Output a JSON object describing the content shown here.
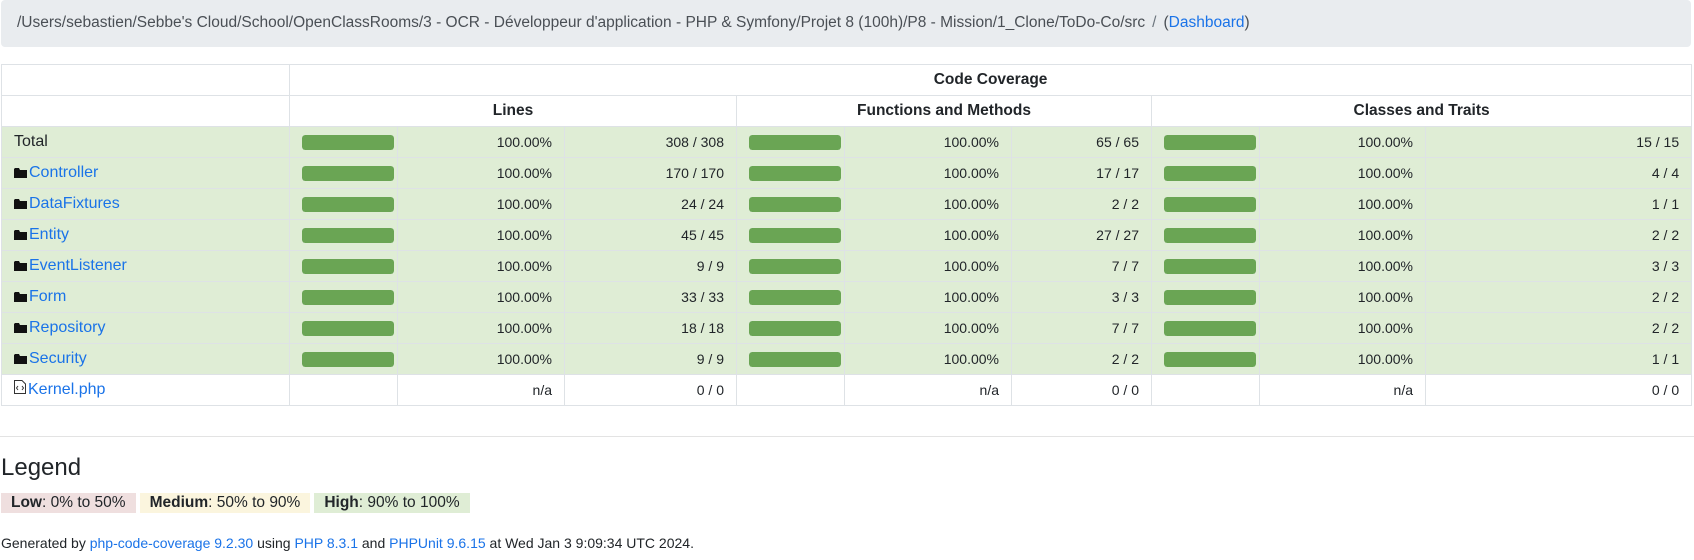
{
  "breadcrumb": {
    "path": "/Users/sebastien/Sebbe's Cloud/School/OpenClassRooms/3 - OCR - Développeur d'application - PHP & Symfony/Projet 8 (100h)/P8 - Mission/1_Clone/ToDo-Co/src",
    "separator": "/",
    "dashboard_label": "Dashboard"
  },
  "table": {
    "group_header": "Code Coverage",
    "headers": [
      "Lines",
      "Functions and Methods",
      "Classes and Traits"
    ],
    "rows": [
      {
        "name": "Total",
        "kind": "total",
        "level": "high",
        "lines": {
          "fill": 1.0,
          "pct": "100.00%",
          "count": "308 / 308"
        },
        "functions": {
          "fill": 1.0,
          "pct": "100.00%",
          "count": "65 / 65"
        },
        "classes": {
          "fill": 1.0,
          "pct": "100.00%",
          "count": "15 / 15"
        }
      },
      {
        "name": "Controller",
        "kind": "dir",
        "level": "high",
        "lines": {
          "fill": 1.0,
          "pct": "100.00%",
          "count": "170 / 170"
        },
        "functions": {
          "fill": 1.0,
          "pct": "100.00%",
          "count": "17 / 17"
        },
        "classes": {
          "fill": 1.0,
          "pct": "100.00%",
          "count": "4 / 4"
        }
      },
      {
        "name": "DataFixtures",
        "kind": "dir",
        "level": "high",
        "lines": {
          "fill": 1.0,
          "pct": "100.00%",
          "count": "24 / 24"
        },
        "functions": {
          "fill": 1.0,
          "pct": "100.00%",
          "count": "2 / 2"
        },
        "classes": {
          "fill": 1.0,
          "pct": "100.00%",
          "count": "1 / 1"
        }
      },
      {
        "name": "Entity",
        "kind": "dir",
        "level": "high",
        "lines": {
          "fill": 1.0,
          "pct": "100.00%",
          "count": "45 / 45"
        },
        "functions": {
          "fill": 1.0,
          "pct": "100.00%",
          "count": "27 / 27"
        },
        "classes": {
          "fill": 1.0,
          "pct": "100.00%",
          "count": "2 / 2"
        }
      },
      {
        "name": "EventListener",
        "kind": "dir",
        "level": "high",
        "lines": {
          "fill": 1.0,
          "pct": "100.00%",
          "count": "9 / 9"
        },
        "functions": {
          "fill": 1.0,
          "pct": "100.00%",
          "count": "7 / 7"
        },
        "classes": {
          "fill": 1.0,
          "pct": "100.00%",
          "count": "3 / 3"
        }
      },
      {
        "name": "Form",
        "kind": "dir",
        "level": "high",
        "lines": {
          "fill": 1.0,
          "pct": "100.00%",
          "count": "33 / 33"
        },
        "functions": {
          "fill": 1.0,
          "pct": "100.00%",
          "count": "3 / 3"
        },
        "classes": {
          "fill": 1.0,
          "pct": "100.00%",
          "count": "2 / 2"
        }
      },
      {
        "name": "Repository",
        "kind": "dir",
        "level": "high",
        "lines": {
          "fill": 1.0,
          "pct": "100.00%",
          "count": "18 / 18"
        },
        "functions": {
          "fill": 1.0,
          "pct": "100.00%",
          "count": "7 / 7"
        },
        "classes": {
          "fill": 1.0,
          "pct": "100.00%",
          "count": "2 / 2"
        }
      },
      {
        "name": "Security",
        "kind": "dir",
        "level": "high",
        "lines": {
          "fill": 1.0,
          "pct": "100.00%",
          "count": "9 / 9"
        },
        "functions": {
          "fill": 1.0,
          "pct": "100.00%",
          "count": "2 / 2"
        },
        "classes": {
          "fill": 1.0,
          "pct": "100.00%",
          "count": "1 / 1"
        }
      },
      {
        "name": "Kernel.php",
        "kind": "file",
        "level": "none",
        "lines": {
          "fill": null,
          "pct": "n/a",
          "count": "0 / 0"
        },
        "functions": {
          "fill": null,
          "pct": "n/a",
          "count": "0 / 0"
        },
        "classes": {
          "fill": null,
          "pct": "n/a",
          "count": "0 / 0"
        }
      }
    ]
  },
  "legend": {
    "title": "Legend",
    "low": {
      "label": "Low",
      "range": ": 0% to 50%"
    },
    "medium": {
      "label": "Medium",
      "range": ": 50% to 90%"
    },
    "high": {
      "label": "High",
      "range": ": 90% to 100%"
    }
  },
  "footer": {
    "prefix": "Generated by ",
    "tool_link": "php-code-coverage 9.2.30",
    "using": " using ",
    "php_link": "PHP 8.3.1",
    "and": " and ",
    "phpunit_link": "PHPUnit 9.6.15",
    "suffix": " at Wed Jan 3 9:09:34 UTC 2024."
  },
  "colors": {
    "high_bg": "#dfedd5",
    "bar_fill": "#6aa554",
    "link": "#1a73e8",
    "low_bg": "#efdfdf",
    "medium_bg": "#fbf5de"
  },
  "icons": {
    "directory": "folder-icon",
    "file": "php-file-icon"
  }
}
